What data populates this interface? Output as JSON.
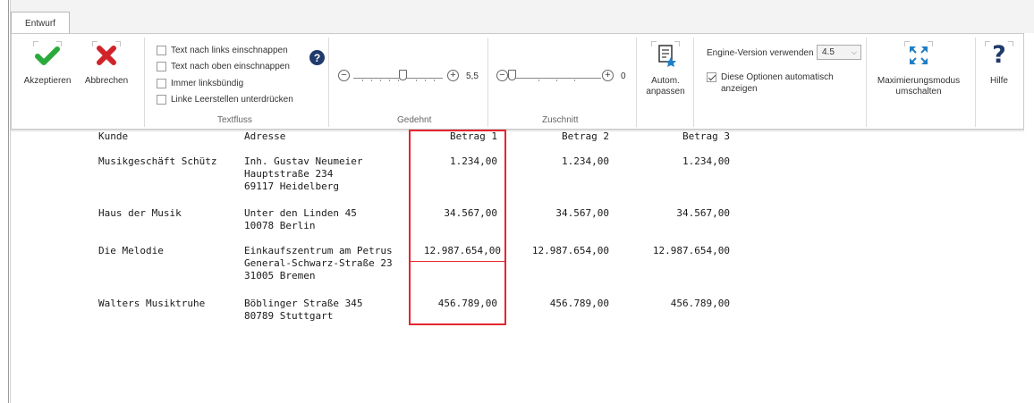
{
  "tab": {
    "label": "Entwurf"
  },
  "ribbon": {
    "accept_label": "Akzeptieren",
    "cancel_label": "Abbrechen",
    "textflow": {
      "options": [
        {
          "label": "Text nach links einschnappen",
          "checked": false
        },
        {
          "label": "Text nach oben einschnappen",
          "checked": false
        },
        {
          "label": "Immer linksbündig",
          "checked": false
        },
        {
          "label": "Linke Leerstellen unterdrücken",
          "checked": false
        }
      ],
      "group_label": "Textfluss",
      "help_glyph": "?"
    },
    "stretched": {
      "value": "5,5",
      "level": 0.55,
      "group_label": "Gedehnt"
    },
    "cut": {
      "value": "0",
      "level": 0.0,
      "group_label": "Zuschnitt"
    },
    "auto_adjust_label": "Autom. anpassen",
    "engine": {
      "label": "Engine-Version verwenden",
      "value": "4.5"
    },
    "show_options": {
      "label": "Diese Optionen automatisch anzeigen",
      "checked": true
    },
    "maximize_label": "Maximierungsmodus umschalten",
    "help_label": "Hilfe",
    "colors": {
      "accept": "#2aaa3b",
      "cancel": "#d1232a",
      "accent": "#1f7fc4"
    }
  },
  "table": {
    "headers": [
      "Kunde",
      "Adresse",
      "Betrag 1",
      "Betrag 2",
      "Betrag 3"
    ],
    "rows": [
      {
        "kunde": "Musikgeschäft Schütz",
        "adresse": [
          "Inh. Gustav Neumeier",
          "Hauptstraße 234",
          "69117 Heidelberg"
        ],
        "b1": "1.234,00",
        "b2": "1.234,00",
        "b3": "1.234,00"
      },
      {
        "kunde": "Haus der Musik",
        "adresse": [
          "Unter den Linden 45",
          "10078 Berlin"
        ],
        "b1": "34.567,00",
        "b2": "34.567,00",
        "b3": "34.567,00"
      },
      {
        "kunde": "Die Melodie",
        "adresse": [
          "Einkaufszentrum am Petrus",
          "General-Schwarz-Straße 23",
          "31005 Bremen"
        ],
        "b1": "12.987.654,00",
        "b2": "12.987.654,00",
        "b3": "12.987.654,00"
      },
      {
        "kunde": "Walters Musiktruhe",
        "adresse": [
          "Böblinger Straße 345",
          "80789 Stuttgart"
        ],
        "b1": "456.789,00",
        "b2": "456.789,00",
        "b3": "456.789,00"
      }
    ],
    "highlight_color": "#e4262e"
  }
}
